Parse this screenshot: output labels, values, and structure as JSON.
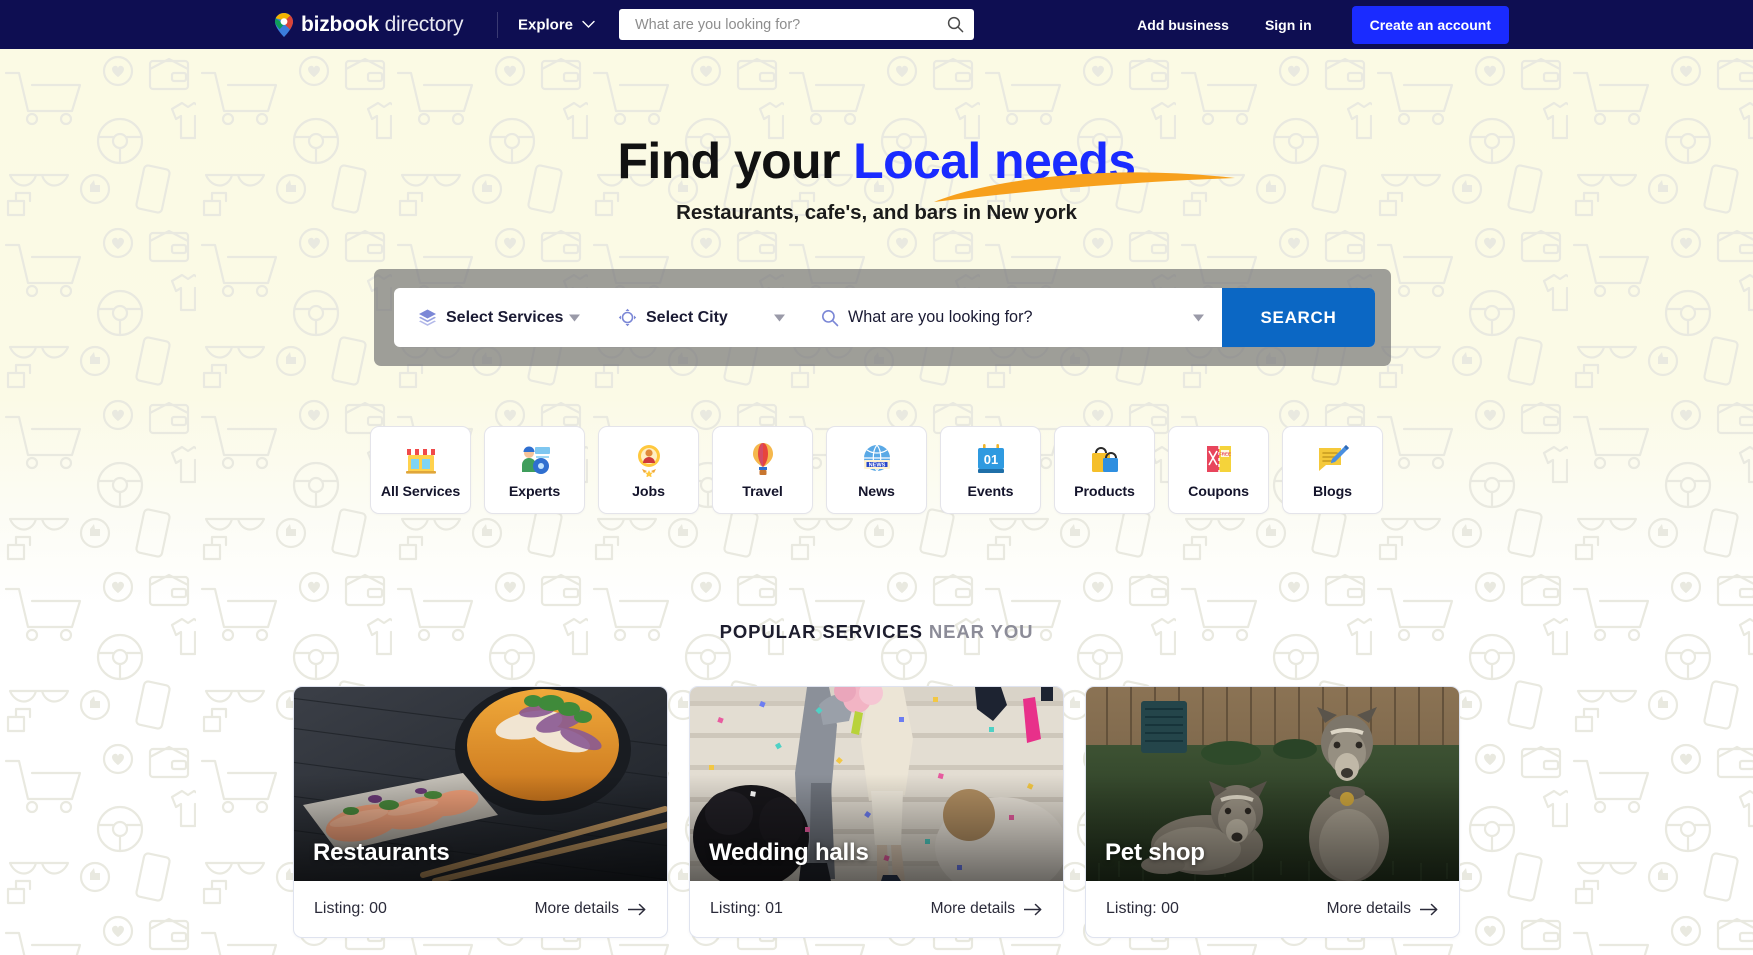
{
  "nav": {
    "brand_bold": "bizbook",
    "brand_light": "directory",
    "brand_icon": "map-pin-icon",
    "explore_label": "Explore",
    "explore_icon": "chevron-down-icon",
    "search_placeholder": "What are you looking for?",
    "search_value": "",
    "search_icon": "search-icon",
    "links": [
      {
        "label": "Add business",
        "name": "add-business"
      },
      {
        "label": "Sign in",
        "name": "sign-in"
      }
    ],
    "cta_label": "Create an account"
  },
  "hero": {
    "headline_part1": "Find your ",
    "headline_accent": "Local needs",
    "subhead": "Restaurants, cafe's, and bars in New york",
    "accent_color": "#1a2bff",
    "swoosh_color": "#f7a01c",
    "background_color": "#fbfae4"
  },
  "search_panel": {
    "service_label": "Select Services",
    "service_icon": "layers-icon",
    "city_label": "Select City",
    "city_icon": "location-target-icon",
    "query_placeholder": "What are you looking for?",
    "query_value": "",
    "query_icon": "search-icon",
    "dropdown_icon": "caret-down-icon",
    "button_label": "SEARCH",
    "button_color": "#0b67c4",
    "frame_color": "rgba(122,122,122,0.72)"
  },
  "categories": [
    {
      "label": "All Services",
      "icon": "storefront-icon"
    },
    {
      "label": "Experts",
      "icon": "worker-icon"
    },
    {
      "label": "Jobs",
      "icon": "job-badge-icon"
    },
    {
      "label": "Travel",
      "icon": "hot-air-balloon-icon"
    },
    {
      "label": "News",
      "icon": "news-globe-icon"
    },
    {
      "label": "Events",
      "icon": "calendar-icon"
    },
    {
      "label": "Products",
      "icon": "shopping-bags-icon"
    },
    {
      "label": "Coupons",
      "icon": "coupon-icon"
    },
    {
      "label": "Blogs",
      "icon": "blog-write-icon"
    }
  ],
  "popular": {
    "title_strong": "POPULAR SERVICES",
    "title_mute": " NEAR YOU",
    "cards": [
      {
        "title": "Restaurants",
        "listing": "Listing: 00",
        "more": "More details",
        "photo": "food-bowl-sushi-photo"
      },
      {
        "title": "Wedding halls",
        "listing": "Listing: 01",
        "more": "More details",
        "photo": "wedding-confetti-photo"
      },
      {
        "title": "Pet shop",
        "listing": "Listing: 00",
        "more": "More details",
        "photo": "two-dogs-garden-photo"
      }
    ],
    "arrow_icon": "arrow-right-icon"
  }
}
